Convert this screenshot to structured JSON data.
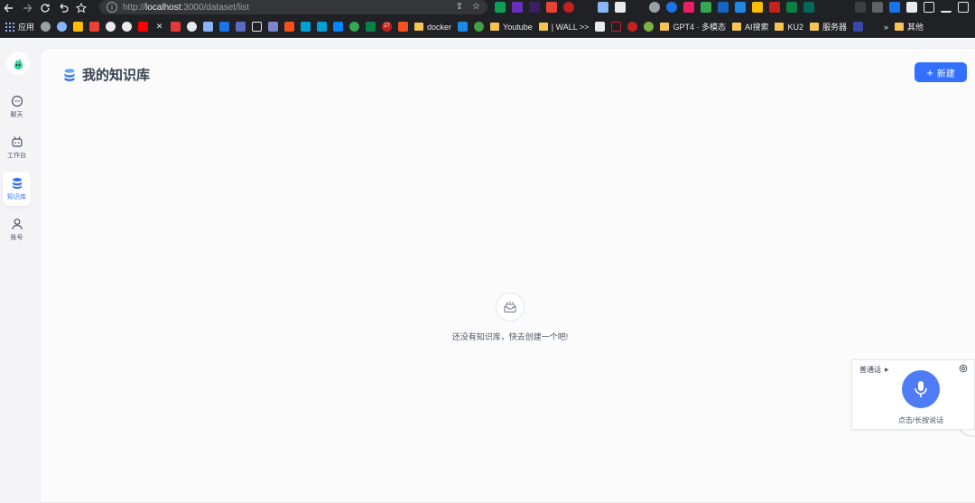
{
  "browser": {
    "url_prefix": "http://",
    "url_host": "localhost",
    "url_rest": ":3000/dataset/list",
    "bookmarks": {
      "apps": "应用",
      "docker": "docker",
      "youtube": "Youtube",
      "wall": "| WALL >>",
      "gpt4": "GPT4 · 多模态",
      "ai_search": "AI搜索",
      "ku2": "KU2",
      "server": "服务器",
      "more": "»",
      "other": "其他"
    },
    "badges": {
      "tab_count": "27",
      "ext_count": "17"
    }
  },
  "sidebar": {
    "items": [
      {
        "label": "聊天",
        "icon": "chat-icon"
      },
      {
        "label": "工作台",
        "icon": "robot-icon"
      },
      {
        "label": "知识库",
        "icon": "database-icon",
        "active": true
      },
      {
        "label": "账号",
        "icon": "user-icon"
      }
    ]
  },
  "header": {
    "title": "我的知识库",
    "new_button_label": "新建"
  },
  "empty_state": {
    "message": "还没有知识库，快去创建一个吧!"
  },
  "voice_widget": {
    "language": "普通话",
    "hint": "点击/长按说话"
  },
  "colors": {
    "accent": "#3370ff",
    "mic": "#4e7cf6",
    "page_bg": "#fbfbfc",
    "sidebar_bg": "#f4f4f7"
  }
}
